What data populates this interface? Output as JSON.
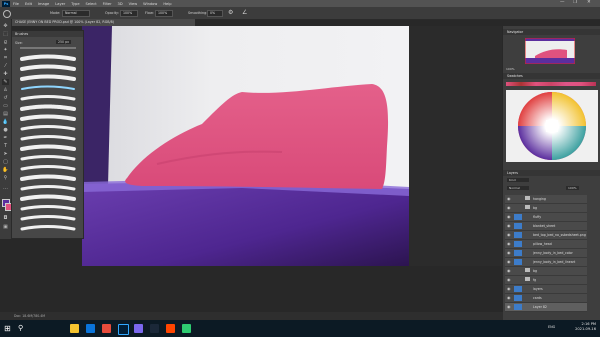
{
  "app": {
    "logo": "Ps"
  },
  "menubar": {
    "items": [
      "File",
      "Edit",
      "Image",
      "Layer",
      "Type",
      "Select",
      "Filter",
      "3D",
      "View",
      "Window",
      "Help"
    ],
    "win_controls": [
      "—",
      "❐",
      "✕"
    ]
  },
  "options": {
    "mode_label": "Mode:",
    "mode_value": "Normal",
    "opacity_label": "Opacity:",
    "opacity_value": "100%",
    "flow_label": "Flow:",
    "flow_value": "100%",
    "smoothing_label": "Smoothing:",
    "smoothing_value": "0%"
  },
  "document": {
    "tab_title": "CHASE JENNY ON BED PROD.psd @ 100% (Layer 82, RGB/8)"
  },
  "brushes": {
    "title": "Brushes",
    "size_label": "Size:",
    "size_value": "250 px"
  },
  "panels": {
    "navigator": "Navigator",
    "swatches": "Swatches",
    "layers": "Layers",
    "zoom": "100%"
  },
  "layers": {
    "search_placeholder": "Kind",
    "blend": "Normal",
    "opacity": "100%",
    "items": [
      {
        "name": "hanging",
        "type": "folder"
      },
      {
        "name": "bg",
        "type": "folder"
      },
      {
        "name": "fluffy",
        "type": "layer"
      },
      {
        "name": "blanket_sheet",
        "type": "layer"
      },
      {
        "name": "bed_top_bed_no_ssbedsheet.png",
        "type": "layer"
      },
      {
        "name": "pillow_head",
        "type": "layer"
      },
      {
        "name": "jenny_body_in_bed_color",
        "type": "layer"
      },
      {
        "name": "jenny_body_in_bed_lineart",
        "type": "layer"
      },
      {
        "name": "bg",
        "type": "folder"
      },
      {
        "name": "fg",
        "type": "folder"
      },
      {
        "name": "layers",
        "type": "layer"
      },
      {
        "name": "cards",
        "type": "layer"
      },
      {
        "name": "Layer 82",
        "type": "layer"
      }
    ]
  },
  "status": {
    "text": "Doc: 18.6M/780.4M"
  },
  "taskbar": {
    "time": "2:16 PM",
    "date": "2021-09-16",
    "lang": "ENG"
  },
  "colors": {
    "pillow": "#e0527f",
    "bed": "#5b2e9e",
    "wall": "#e6e6ea",
    "accent": "#31a8ff"
  }
}
